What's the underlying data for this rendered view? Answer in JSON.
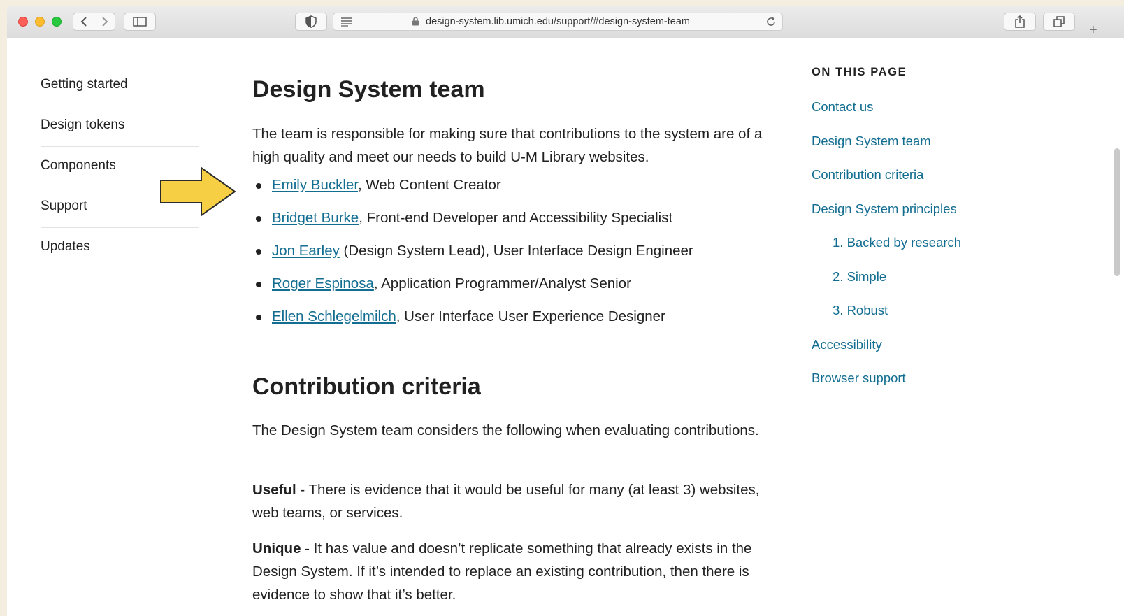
{
  "browser": {
    "url": "design-system.lib.umich.edu/support/#design-system-team",
    "new_tab": "+"
  },
  "sidebar": {
    "items": [
      {
        "label": "Getting started"
      },
      {
        "label": "Design tokens"
      },
      {
        "label": "Components"
      },
      {
        "label": "Support"
      },
      {
        "label": "Updates"
      }
    ]
  },
  "main": {
    "team_heading": "Design System team",
    "team_intro": "The team is responsible for making sure that contributions to the system are of a high quality and meet our needs to build U-M Library websites.",
    "team": [
      {
        "name": "Emily Buckler",
        "role": ", Web Content Creator"
      },
      {
        "name": "Bridget Burke",
        "role": ", Front-end Developer and Accessibility Specialist"
      },
      {
        "name": "Jon Earley",
        "role": " (Design System Lead), User Interface Design Engineer"
      },
      {
        "name": "Roger Espinosa",
        "role": ", Application Programmer/Analyst Senior"
      },
      {
        "name": "Ellen Schlegelmilch",
        "role": ", User Interface User Experience Designer"
      }
    ],
    "criteria_heading": "Contribution criteria",
    "criteria_intro": "The Design System team considers the following when evaluating contributions.",
    "useful_term": "Useful",
    "useful_text": " - There is evidence that it would be useful for many (at least 3) websites, web teams, or services.",
    "unique_term": "Unique",
    "unique_text": " - It has value and doesn’t replicate something that already exists in the Design System. If it’s intended to replace an existing contribution, then there is evidence to show that it’s better."
  },
  "toc": {
    "heading": "ON THIS PAGE",
    "links": [
      {
        "label": "Contact us"
      },
      {
        "label": "Design System team"
      },
      {
        "label": "Contribution criteria"
      },
      {
        "label": "Design System principles"
      },
      {
        "label": "1. Backed by research"
      },
      {
        "label": "2. Simple"
      },
      {
        "label": "3. Robust"
      },
      {
        "label": "Accessibility"
      },
      {
        "label": "Browser support"
      }
    ]
  },
  "colors": {
    "link": "#126d91",
    "text": "#212121",
    "arrow_fill": "#f7cf45"
  }
}
